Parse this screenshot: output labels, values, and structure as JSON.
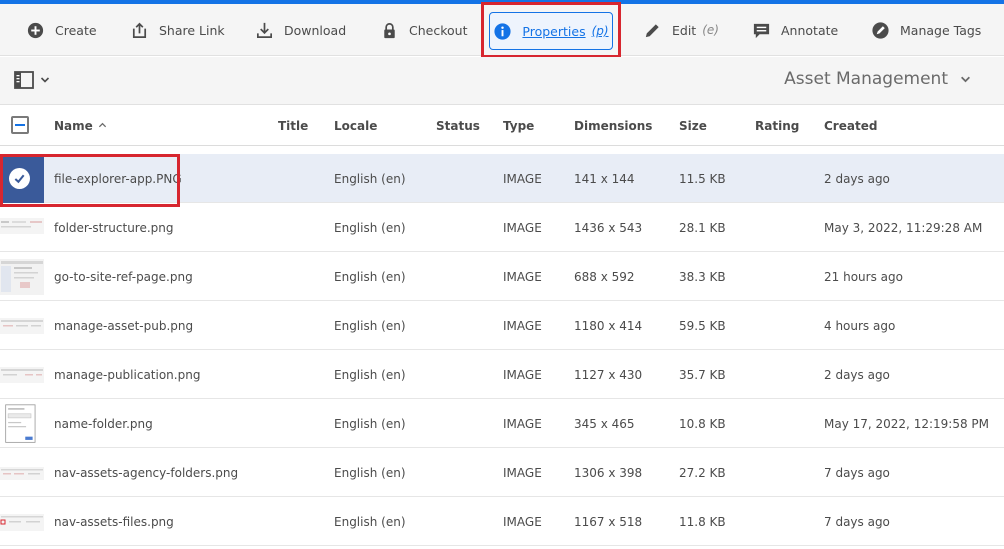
{
  "toolbar": {
    "create": "Create",
    "share_link": "Share Link",
    "download": "Download",
    "checkout": "Checkout",
    "properties": "Properties",
    "properties_key": "(p)",
    "edit": "Edit",
    "edit_key": "(e)",
    "annotate": "Annotate",
    "manage_tags": "Manage Tags"
  },
  "subbar": {
    "context_title": "Asset Management"
  },
  "columns": {
    "name": "Name",
    "title": "Title",
    "locale": "Locale",
    "status": "Status",
    "type": "Type",
    "dimensions": "Dimensions",
    "size": "Size",
    "rating": "Rating",
    "created": "Created"
  },
  "rows": [
    {
      "name": "file-explorer-app.PNG",
      "locale": "English (en)",
      "type": "IMAGE",
      "dimensions": "141 x 144",
      "size": "11.5 KB",
      "created": "2 days ago"
    },
    {
      "name": "folder-structure.png",
      "locale": "English (en)",
      "type": "IMAGE",
      "dimensions": "1436 x 543",
      "size": "28.1 KB",
      "created": "May 3, 2022, 11:29:28 AM"
    },
    {
      "name": "go-to-site-ref-page.png",
      "locale": "English (en)",
      "type": "IMAGE",
      "dimensions": "688 x 592",
      "size": "38.3 KB",
      "created": "21 hours ago"
    },
    {
      "name": "manage-asset-pub.png",
      "locale": "English (en)",
      "type": "IMAGE",
      "dimensions": "1180 x 414",
      "size": "59.5 KB",
      "created": "4 hours ago"
    },
    {
      "name": "manage-publication.png",
      "locale": "English (en)",
      "type": "IMAGE",
      "dimensions": "1127 x 430",
      "size": "35.7 KB",
      "created": "2 days ago"
    },
    {
      "name": "name-folder.png",
      "locale": "English (en)",
      "type": "IMAGE",
      "dimensions": "345 x 465",
      "size": "10.8 KB",
      "created": "May 17, 2022, 12:19:58 PM"
    },
    {
      "name": "nav-assets-agency-folders.png",
      "locale": "English (en)",
      "type": "IMAGE",
      "dimensions": "1306 x 398",
      "size": "27.2 KB",
      "created": "7 days ago"
    },
    {
      "name": "nav-assets-files.png",
      "locale": "English (en)",
      "type": "IMAGE",
      "dimensions": "1167 x 518",
      "size": "11.8 KB",
      "created": "7 days ago"
    }
  ],
  "colors": {
    "accent": "#1473e6",
    "highlight": "#d7262f",
    "selected_row": "#e8edf6"
  }
}
